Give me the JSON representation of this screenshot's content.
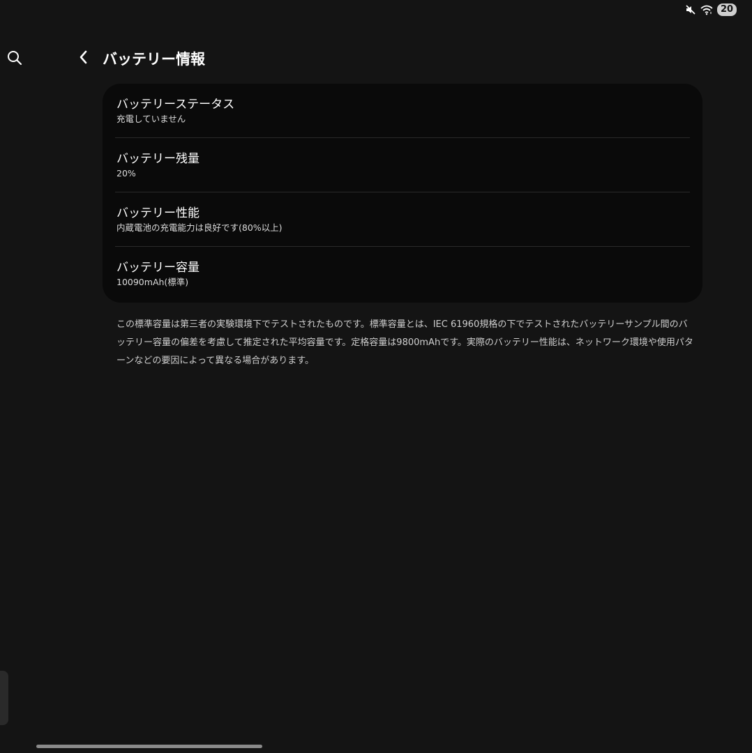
{
  "status_bar": {
    "icons": [
      "mute-icon",
      "wifi-icon"
    ],
    "battery_level": "20"
  },
  "header": {
    "title": "バッテリー情報"
  },
  "items": [
    {
      "title": "バッテリーステータス",
      "subtitle": "充電していません"
    },
    {
      "title": "バッテリー残量",
      "subtitle": "20%"
    },
    {
      "title": "バッテリー性能",
      "subtitle": "内蔵電池の充電能力は良好です(80%以上)"
    },
    {
      "title": "バッテリー容量",
      "subtitle": "10090mAh(標準)"
    }
  ],
  "note": "この標準容量は第三者の実験環境下でテストされたものです。標準容量とは、IEC 61960規格の下でテストされたバッテリーサンプル間のバッテリー容量の偏差を考慮して推定された平均容量です。定格容量は9800mAhです。実際のバッテリー性能は、ネットワーク環境や使用パターンなどの要因によって異なる場合があります。",
  "colors": {
    "background": "#141414",
    "card": "#0a0a0a",
    "text": "#ffffff"
  }
}
